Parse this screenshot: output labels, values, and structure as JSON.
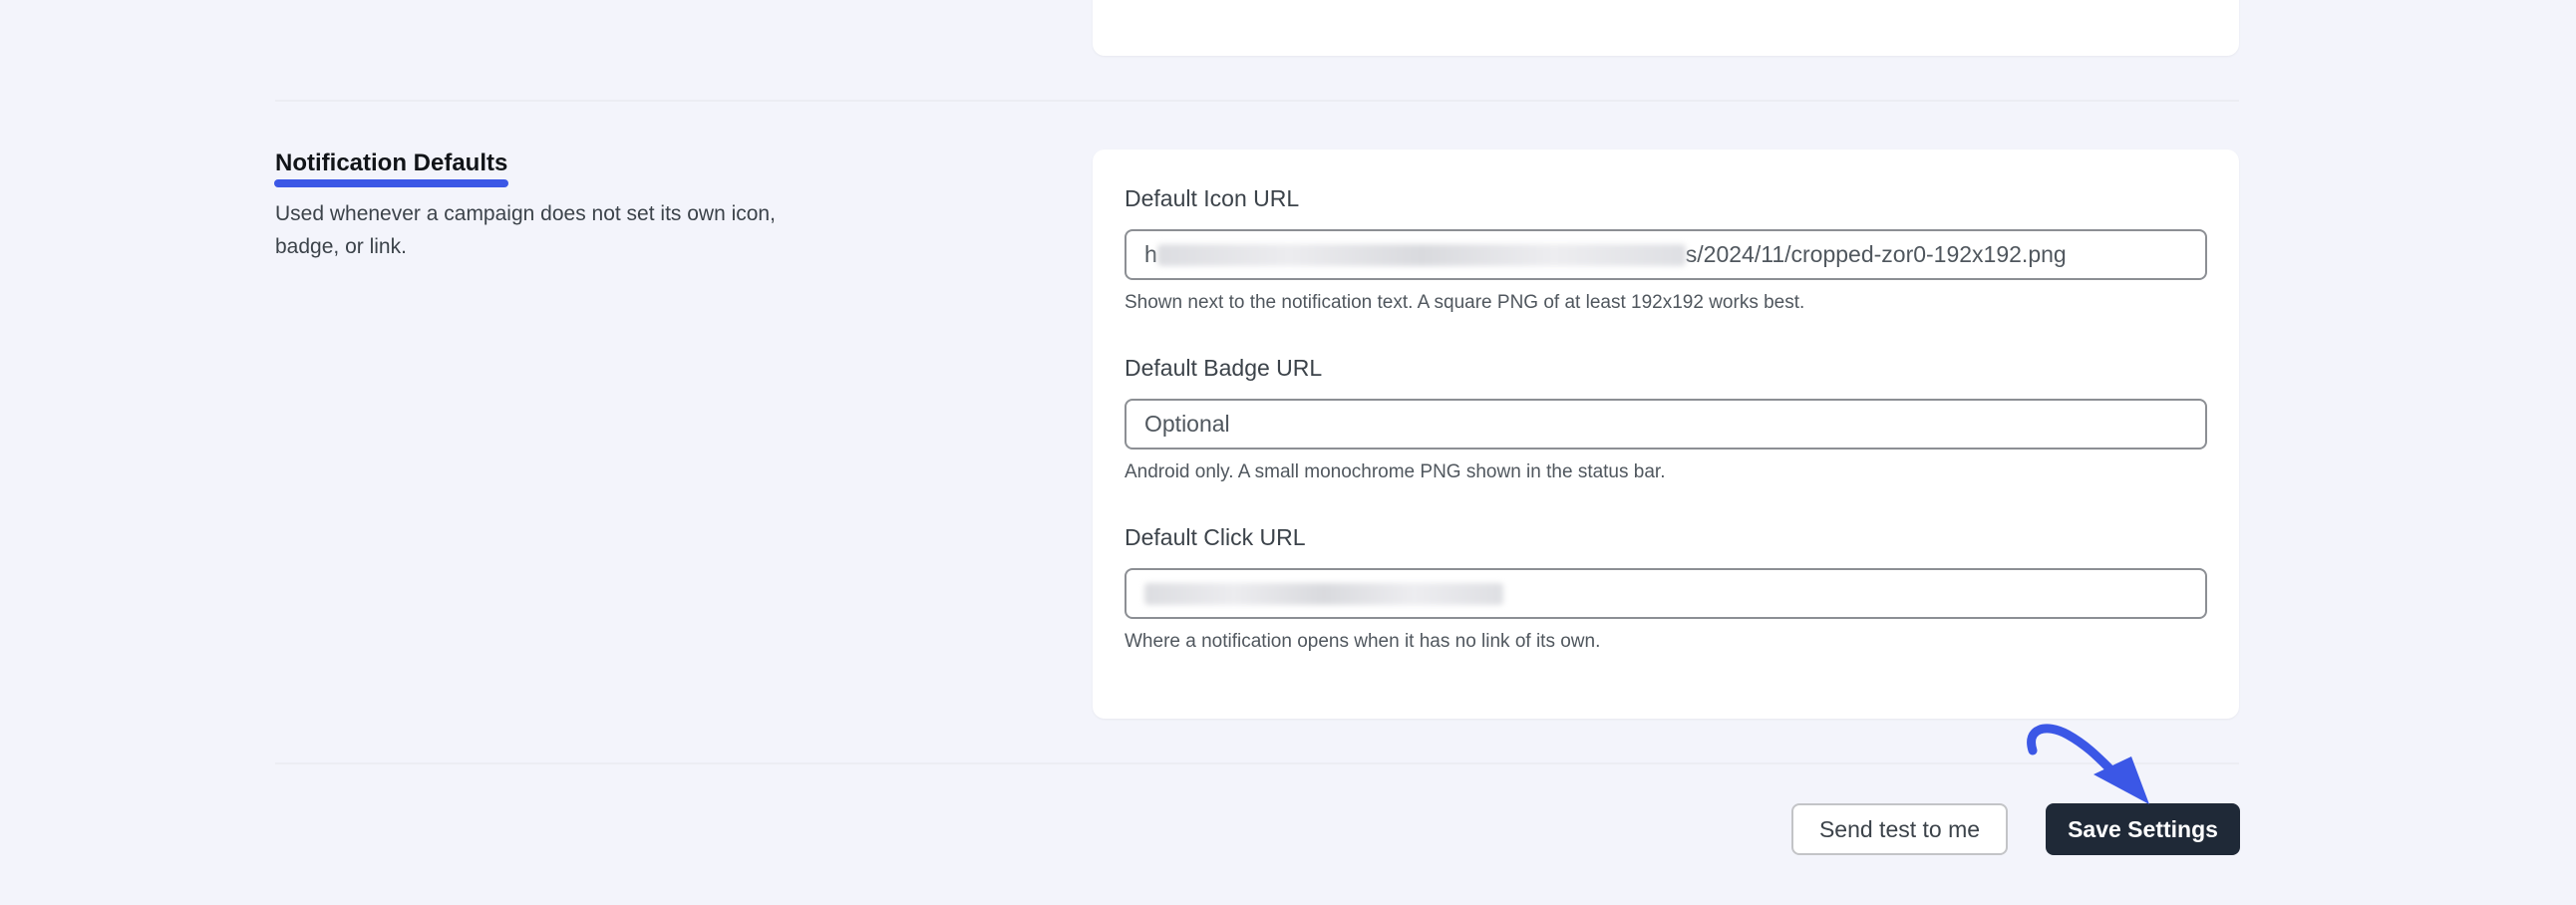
{
  "section": {
    "title": "Notification Defaults",
    "description": "Used whenever a campaign does not set its own icon, badge, or link."
  },
  "fields": {
    "icon": {
      "label": "Default Icon URL",
      "value_prefix": "h",
      "value_suffix": "s/2024/11/cropped-zor0-192x192.png",
      "help": "Shown next to the notification text. A square PNG of at least 192x192 works best."
    },
    "badge": {
      "label": "Default Badge URL",
      "placeholder": "Optional",
      "help": "Android only. A small monochrome PNG shown in the status bar."
    },
    "click": {
      "label": "Default Click URL",
      "help": "Where a notification opens when it has no link of its own."
    }
  },
  "actions": {
    "send_test_label": "Send test to me",
    "save_label": "Save Settings"
  },
  "colors": {
    "accent": "#3b57e6",
    "primary_button": "#1f2937",
    "page_background": "#f3f4fb"
  }
}
